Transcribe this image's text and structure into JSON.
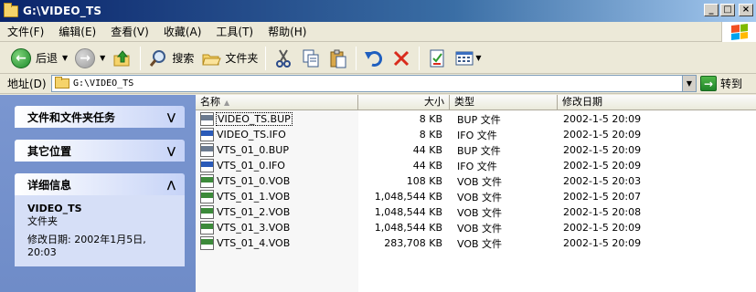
{
  "window": {
    "title": "G:\\VIDEO_TS"
  },
  "window_buttons": {
    "minimize": "_",
    "maximize": "□",
    "close": "×"
  },
  "menu": [
    "文件(F)",
    "编辑(E)",
    "查看(V)",
    "收藏(A)",
    "工具(T)",
    "帮助(H)"
  ],
  "toolbar": {
    "back_label": "后退",
    "search_label": "搜索",
    "folders_label": "文件夹"
  },
  "address": {
    "label": "地址(D)",
    "value": "G:\\VIDEO_TS",
    "go_label": "转到"
  },
  "left_pane": {
    "tasks_title": "文件和文件夹任务",
    "places_title": "其它位置",
    "details_title": "详细信息",
    "details": {
      "name": "VIDEO_TS",
      "type": "文件夹",
      "modified": "修改日期: 2002年1月5日, 20:03"
    }
  },
  "columns": {
    "name": "名称",
    "size": "大小",
    "type": "类型",
    "date": "修改日期"
  },
  "files": [
    {
      "name": "VIDEO_TS.BUP",
      "size": "8 KB",
      "type": "BUP 文件",
      "date": "2002-1-5 20:09",
      "icon": "bup"
    },
    {
      "name": "VIDEO_TS.IFO",
      "size": "8 KB",
      "type": "IFO 文件",
      "date": "2002-1-5 20:09",
      "icon": "ifo"
    },
    {
      "name": "VTS_01_0.BUP",
      "size": "44 KB",
      "type": "BUP 文件",
      "date": "2002-1-5 20:09",
      "icon": "bup"
    },
    {
      "name": "VTS_01_0.IFO",
      "size": "44 KB",
      "type": "IFO 文件",
      "date": "2002-1-5 20:09",
      "icon": "ifo"
    },
    {
      "name": "VTS_01_0.VOB",
      "size": "108 KB",
      "type": "VOB 文件",
      "date": "2002-1-5 20:03",
      "icon": "vob"
    },
    {
      "name": "VTS_01_1.VOB",
      "size": "1,048,544 KB",
      "type": "VOB 文件",
      "date": "2002-1-5 20:07",
      "icon": "vob"
    },
    {
      "name": "VTS_01_2.VOB",
      "size": "1,048,544 KB",
      "type": "VOB 文件",
      "date": "2002-1-5 20:08",
      "icon": "vob"
    },
    {
      "name": "VTS_01_3.VOB",
      "size": "1,048,544 KB",
      "type": "VOB 文件",
      "date": "2002-1-5 20:09",
      "icon": "vob"
    },
    {
      "name": "VTS_01_4.VOB",
      "size": "283,708 KB",
      "type": "VOB 文件",
      "date": "2002-1-5 20:09",
      "icon": "vob"
    }
  ]
}
